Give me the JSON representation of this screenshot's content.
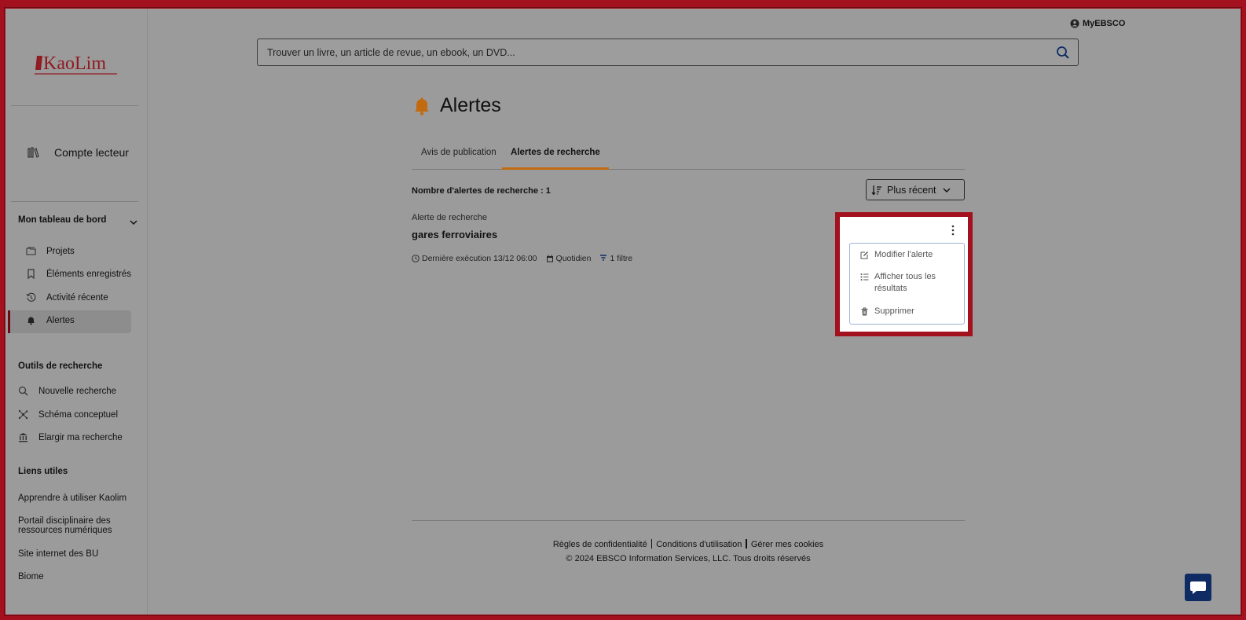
{
  "sidebar": {
    "logo_text": "KaoLim",
    "account_label": "Compte lecteur",
    "dashboard_title": "Mon tableau de bord",
    "dashboard_items": [
      {
        "label": "Projets",
        "icon": "folder-icon"
      },
      {
        "label": "Éléments enregistrés",
        "icon": "bookmark-icon"
      },
      {
        "label": "Activité récente",
        "icon": "history-icon"
      },
      {
        "label": "Alertes",
        "icon": "bell-icon",
        "active": true
      }
    ],
    "tools_title": "Outils de recherche",
    "tools_items": [
      {
        "label": "Nouvelle recherche",
        "icon": "search-icon"
      },
      {
        "label": "Schéma conceptuel",
        "icon": "concept-map-icon"
      },
      {
        "label": "Elargir ma recherche",
        "icon": "institution-icon"
      }
    ],
    "links_title": "Liens utiles",
    "links": [
      "Apprendre à utiliser Kaolim",
      "Portail disciplinaire des ressources numériques",
      "Site internet des BU",
      "Biome"
    ]
  },
  "header": {
    "search_placeholder": "Trouver un livre, un article de revue, un ebook, un DVD...",
    "myebsco_label": "MyEBSCO"
  },
  "main": {
    "title": "Alertes",
    "tabs": [
      {
        "label": "Avis de publication",
        "active": false
      },
      {
        "label": "Alertes de recherche",
        "active": true
      }
    ],
    "count_label": "Nombre d'alertes de recherche : 1",
    "sort_label": "Plus récent",
    "alert": {
      "type_label": "Alerte de recherche",
      "name": "gares ferroviaires",
      "last_run": "Dernière exécution 13/12 06:00",
      "frequency": "Quotidien",
      "filters": "1 filtre"
    },
    "menu": [
      {
        "label": "Modifier l'alerte",
        "icon": "edit-icon"
      },
      {
        "label": "Afficher tous les résultats",
        "icon": "list-icon"
      },
      {
        "label": "Supprimer",
        "icon": "trash-icon"
      }
    ]
  },
  "footer": {
    "links": [
      "Règles de confidentialité",
      "Conditions d'utilisation",
      "Gérer mes cookies"
    ],
    "copyright": "© 2024 EBSCO Information Services, LLC. Tous droits réservés"
  },
  "colors": {
    "brand": "#a3101e",
    "accent": "#c26a0f",
    "chat": "#0e2c63"
  }
}
